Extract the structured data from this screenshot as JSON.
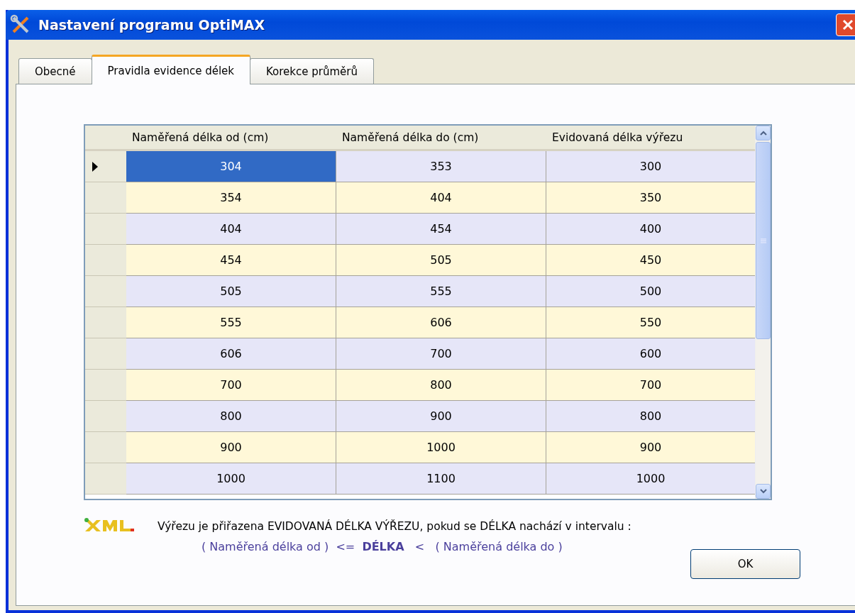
{
  "window": {
    "title": "Nastavení programu OptiMAX"
  },
  "tabs": [
    {
      "label": "Obecné",
      "selected": false
    },
    {
      "label": "Pravidla evidence délek",
      "selected": true
    },
    {
      "label": "Korekce průměrů",
      "selected": false
    }
  ],
  "table": {
    "columns": [
      "Naměřená délka od (cm)",
      "Naměřená délka do (cm)",
      "Evidovaná délka výřezu"
    ],
    "rows": [
      {
        "cells": [
          "304",
          "353",
          "300"
        ],
        "selected": true
      },
      {
        "cells": [
          "354",
          "404",
          "350"
        ],
        "selected": false
      },
      {
        "cells": [
          "404",
          "454",
          "400"
        ],
        "selected": false
      },
      {
        "cells": [
          "454",
          "505",
          "450"
        ],
        "selected": false
      },
      {
        "cells": [
          "505",
          "555",
          "500"
        ],
        "selected": false
      },
      {
        "cells": [
          "555",
          "606",
          "550"
        ],
        "selected": false
      },
      {
        "cells": [
          "606",
          "700",
          "600"
        ],
        "selected": false
      },
      {
        "cells": [
          "700",
          "800",
          "700"
        ],
        "selected": false
      },
      {
        "cells": [
          "800",
          "900",
          "800"
        ],
        "selected": false
      },
      {
        "cells": [
          "900",
          "1000",
          "900"
        ],
        "selected": false
      },
      {
        "cells": [
          "1000",
          "1100",
          "1000"
        ],
        "selected": false
      }
    ]
  },
  "note": "Výřezu je přiřazena  EVIDOVANÁ DÉLKA VÝŘEZU,  pokud se DÉLKA nachází v intervalu :",
  "formula": "( Naměřená délka od )  <=  **DÉLKA**   <   ( Naměřená délka do )",
  "buttons": [
    "OK"
  ]
}
